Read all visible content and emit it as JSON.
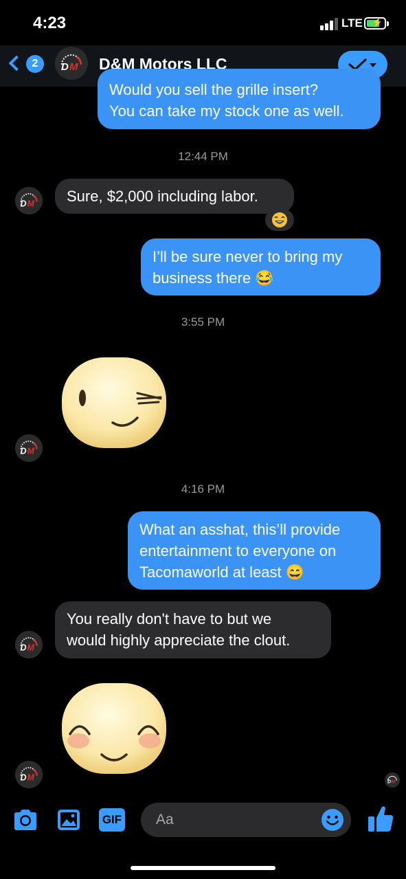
{
  "status": {
    "time": "4:23",
    "network": "LTE"
  },
  "header": {
    "unread_count": "2",
    "contact_name": "D&M Motors LLC"
  },
  "messages": [
    {
      "text": "Would you sell the grille insert? You can take my stock one as well.",
      "direction": "outgoing"
    },
    {
      "text": "12:44 PM",
      "type": "timestamp"
    },
    {
      "text": "Sure, $2,000 including labor.",
      "direction": "incoming",
      "reaction": "face-with-tears-of-joy"
    },
    {
      "text": "I'll be sure never to bring my business there 😂",
      "direction": "outgoing"
    },
    {
      "text": "3:55 PM",
      "type": "timestamp"
    },
    {
      "sticker": "winking-face-sticker",
      "direction": "incoming"
    },
    {
      "text": "4:16 PM",
      "type": "timestamp"
    },
    {
      "text": "What an asshat, this'll provide entertainment to everyone on Tacomaworld at least 😄",
      "direction": "outgoing"
    },
    {
      "text": "You really don't have to but we would highly appreciate the clout.",
      "direction": "incoming"
    },
    {
      "sticker": "smiling-blush-face-sticker",
      "direction": "incoming"
    }
  ],
  "bubbles": {
    "m1_line1": "Would you sell the grille insert?",
    "m1_line2": "You can take my stock one as well.",
    "ts1": "12:44 PM",
    "m2": "Sure, $2,000 including labor.",
    "m3_line1": "I’ll be sure never to bring my",
    "m3_line2": "business there 😂",
    "ts2": "3:55 PM",
    "ts3": "4:16 PM",
    "m4_line1": "What an asshat, this’ll provide",
    "m4_line2": "entertainment to everyone on",
    "m4_line3": "Tacomaworld at least 😄",
    "m5_line1": "You really don't have to but we",
    "m5_line2": "would highly appreciate the clout."
  },
  "reaction_emoji": "😂",
  "composer": {
    "placeholder": "Aa",
    "gif_label": "GIF"
  },
  "colors": {
    "accent": "#3b9cff",
    "outgoing_bubble": "#3b94f5",
    "incoming_bubble": "#2c2c2e",
    "logo_red": "#d6322b"
  },
  "icons": [
    "back-chevron-icon",
    "verified-check-icon",
    "camera-icon",
    "image-icon",
    "gif-icon",
    "emoji-icon",
    "thumbs-up-icon"
  ]
}
